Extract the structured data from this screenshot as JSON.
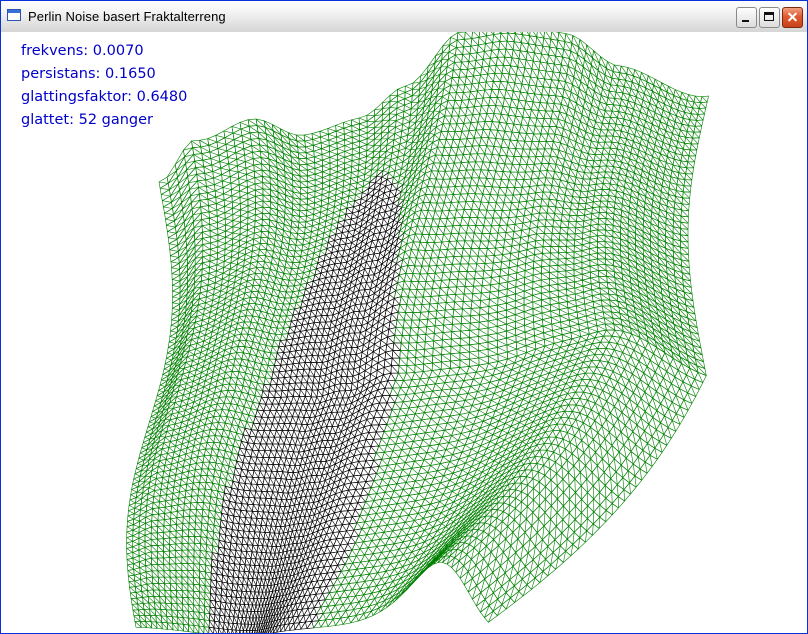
{
  "window": {
    "title": "Perlin Noise basert Fraktalterreng",
    "icon": "application-window-icon",
    "controls": [
      "minimize-icon",
      "maximize-icon",
      "close-icon"
    ]
  },
  "overlay": {
    "frequency": "frekvens: 0.0070",
    "persistence": "persistans: 0.1650",
    "smoothing_factor": "glattingsfaktor: 0.6480",
    "smoothed": "glattet: 52 ganger"
  },
  "colors": {
    "overlay_text": "#0000c8",
    "mesh_near": "#000000",
    "mesh_far": "#008000",
    "background": "#ffffff"
  }
}
